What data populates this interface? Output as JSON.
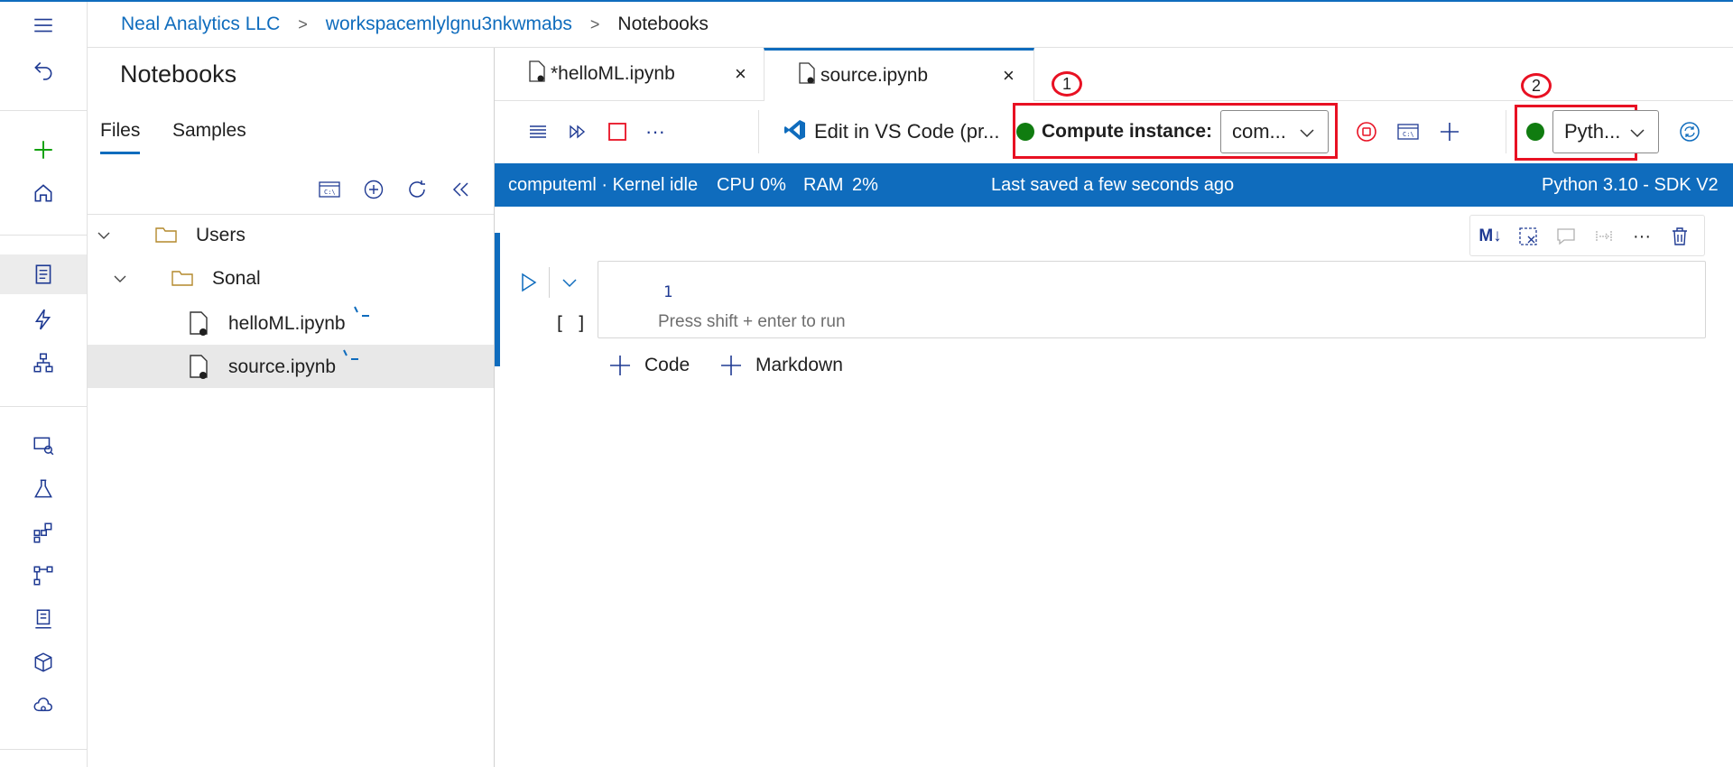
{
  "breadcrumb": {
    "org": "Neal Analytics LLC",
    "workspace": "workspacemlylgnu3nkwmabs",
    "current": "Notebooks"
  },
  "panel": {
    "title": "Notebooks",
    "tabs": {
      "files": "Files",
      "samples": "Samples"
    },
    "tree": {
      "users": "Users",
      "sonal": "Sonal",
      "file1": "helloML.ipynb",
      "file2": "source.ipynb"
    }
  },
  "tabs": {
    "tab1": "*helloML.ipynb",
    "tab2": "source.ipynb",
    "close": "×"
  },
  "toolbar": {
    "edit_vscode": "Edit in VS Code (pr...",
    "compute_label": "Compute instance:",
    "compute_value": "com...",
    "kernel_value": "Pyth...",
    "annot1": "1",
    "annot2": "2",
    "more": "···"
  },
  "status": {
    "compute": "computeml · Kernel idle",
    "cpu_label": "CPU",
    "cpu": "0%",
    "ram_label": "RAM",
    "ram": "2%",
    "saved": "Last saved a few seconds ago",
    "kernel": "Python 3.10 - SDK V2"
  },
  "cell": {
    "line_number": "1",
    "placeholder": "Press shift + enter to run",
    "exec_count": "[ ]",
    "md_label": "M↓",
    "more": "···"
  },
  "add": {
    "code": "Code",
    "markdown": "Markdown"
  },
  "colors": {
    "accent": "#0f6cbd",
    "running": "#107c10",
    "highlight": "#e81123"
  }
}
